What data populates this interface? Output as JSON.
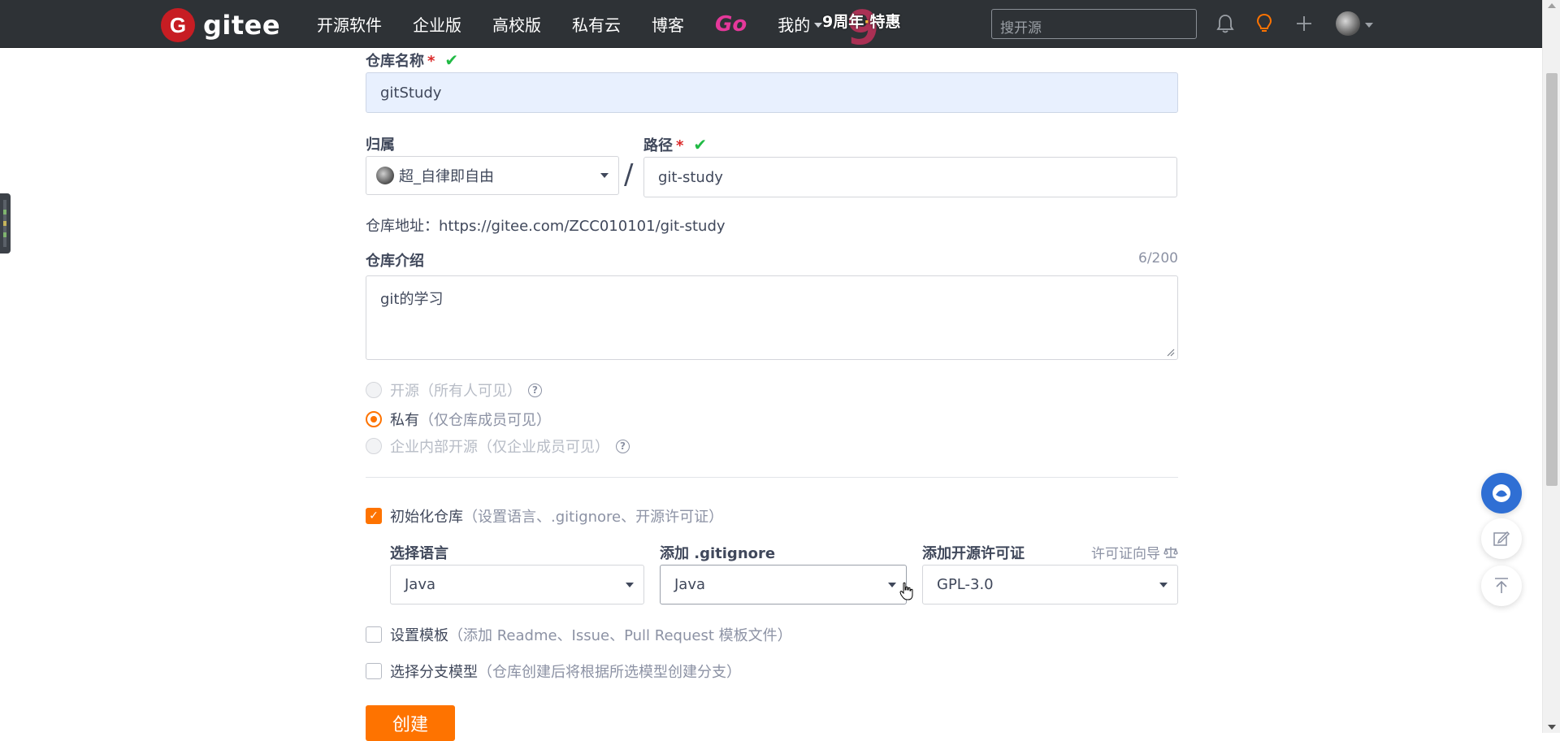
{
  "header": {
    "logo_letter": "G",
    "logo_text": "gitee",
    "nav": [
      "开源软件",
      "企业版",
      "高校版",
      "私有云",
      "博客"
    ],
    "go_label": "Go",
    "mine_label": "我的",
    "promo_nine": "9",
    "promo_text_a": "9周年",
    "promo_text_b": "特惠",
    "search_placeholder": "搜开源"
  },
  "form": {
    "repo_name_label": "仓库名称",
    "repo_name_value": "gitStudy",
    "owner_label": "归属",
    "owner_value": "超_自律即自由",
    "slash": "/",
    "path_label": "路径",
    "path_value": "git-study",
    "required_mark": "*",
    "check_mark": "✔",
    "address_prefix": "仓库地址：",
    "address_url": "https://gitee.com/ZCC010101/git-study",
    "desc_label": "仓库介绍",
    "desc_counter": "6/200",
    "desc_value": "git的学习",
    "visibility": [
      {
        "label": "开源",
        "hint": "（所有人可见）",
        "selected": false,
        "disabled": true,
        "help": true
      },
      {
        "label": "私有",
        "hint": "（仅仓库成员可见）",
        "selected": true,
        "disabled": false,
        "help": false
      },
      {
        "label": "企业内部开源",
        "hint": "（仅企业成员可见）",
        "selected": false,
        "disabled": true,
        "help": true
      }
    ],
    "init_label": "初始化仓库",
    "init_hint": "（设置语言、.gitignore、开源许可证）",
    "lang_label": "选择语言",
    "lang_value": "Java",
    "gitignore_label": "添加 .gitignore",
    "gitignore_value": "Java",
    "license_label": "添加开源许可证",
    "license_wizard": "许可证向导",
    "license_value": "GPL-3.0",
    "template_label": "设置模板",
    "template_hint": "（添加 Readme、Issue、Pull Request 模板文件）",
    "branch_label": "选择分支模型",
    "branch_hint": "（仓库创建后将根据所选模型创建分支）",
    "create_button": "创建"
  },
  "colors": {
    "accent": "#fe7300",
    "navbar": "#2e3236",
    "success": "#21ba45",
    "required": "#db2828"
  }
}
